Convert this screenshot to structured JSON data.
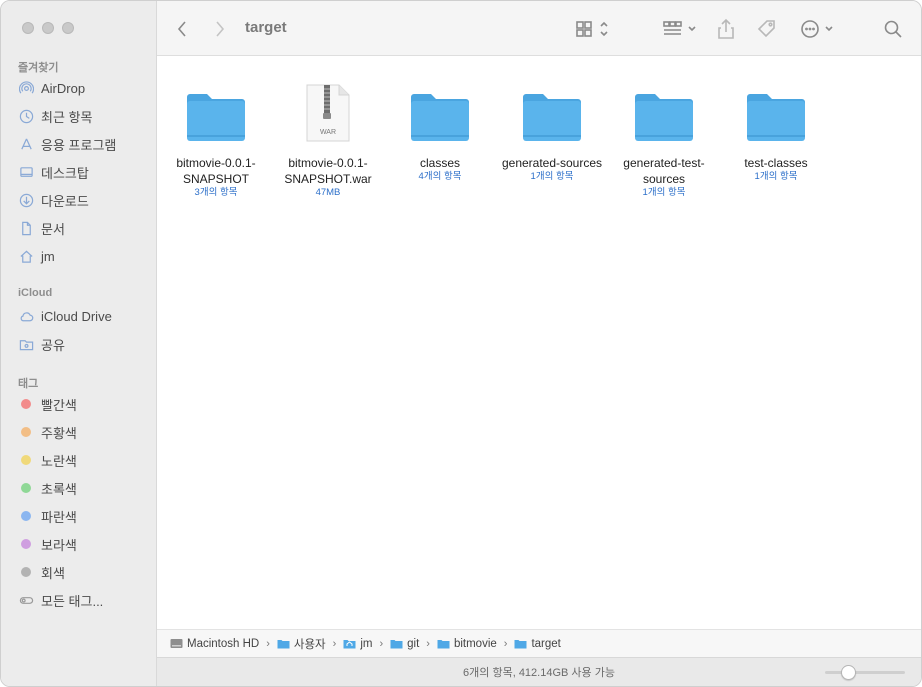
{
  "window": {
    "title": "target"
  },
  "sidebar": {
    "favorites_title": "즐겨찾기",
    "favorites": [
      {
        "label": "AirDrop",
        "icon": "airdrop-icon"
      },
      {
        "label": "최근 항목",
        "icon": "clock-icon"
      },
      {
        "label": "응용 프로그램",
        "icon": "applications-icon"
      },
      {
        "label": "데스크탑",
        "icon": "desktop-icon"
      },
      {
        "label": "다운로드",
        "icon": "download-icon"
      },
      {
        "label": "문서",
        "icon": "document-icon"
      },
      {
        "label": "jm",
        "icon": "home-icon"
      }
    ],
    "icloud_title": "iCloud",
    "icloud": [
      {
        "label": "iCloud Drive",
        "icon": "cloud-icon"
      },
      {
        "label": "공유",
        "icon": "shared-folder-icon"
      }
    ],
    "tags_title": "태그",
    "tags": [
      {
        "label": "빨간색",
        "color": "#f28b8b"
      },
      {
        "label": "주황색",
        "color": "#f2be86"
      },
      {
        "label": "노란색",
        "color": "#f0d97a"
      },
      {
        "label": "초록색",
        "color": "#8fd896"
      },
      {
        "label": "파란색",
        "color": "#8bb6f0"
      },
      {
        "label": "보라색",
        "color": "#cf9ee0"
      },
      {
        "label": "회색",
        "color": "#b3b3b3"
      },
      {
        "label": "모든 태그..."
      }
    ]
  },
  "files": [
    {
      "name": "bitmovie-0.0.1-SNAPSHOT",
      "meta": "3개의 항목",
      "kind": "folder"
    },
    {
      "name": "bitmovie-0.0.1-SNAPSHOT.war",
      "meta": "47MB",
      "kind": "war",
      "badge": "WAR"
    },
    {
      "name": "classes",
      "meta": "4개의 항목",
      "kind": "folder"
    },
    {
      "name": "generated-sources",
      "meta": "1개의 항목",
      "kind": "folder"
    },
    {
      "name": "generated-test-sources",
      "meta": "1개의 항목",
      "kind": "folder"
    },
    {
      "name": "test-classes",
      "meta": "1개의 항목",
      "kind": "folder"
    }
  ],
  "pathbar": [
    "Macintosh HD",
    "사용자",
    "jm",
    "git",
    "bitmovie",
    "target"
  ],
  "status": {
    "text": "6개의 항목, 412.14GB 사용 가능"
  },
  "zoom": {
    "level": 0.25
  },
  "colors": {
    "folder": "#5ab4ec",
    "folder_tab": "#4aa5e0",
    "meta": "#2c6fc9"
  }
}
